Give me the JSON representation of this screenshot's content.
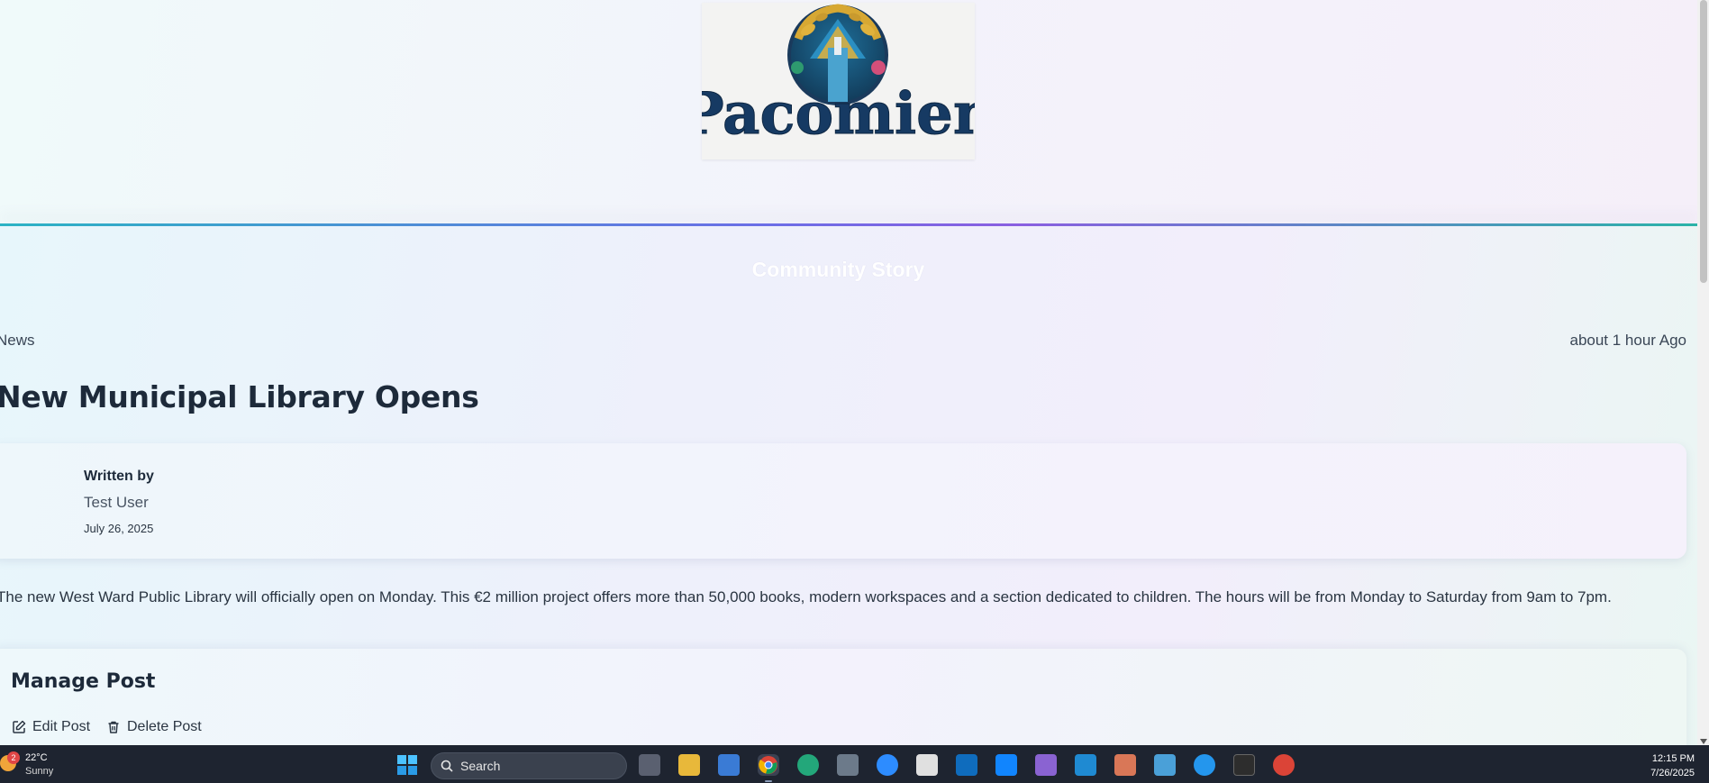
{
  "logo": {
    "text": "Pacomien"
  },
  "section": {
    "title": "Community Story"
  },
  "post": {
    "category": "News",
    "time_ago": "about 1 hour Ago",
    "title": "New Municipal Library Opens",
    "author_label": "Written by",
    "author": "Test User",
    "date": "July 26, 2025",
    "body": "The new West Ward Public Library will officially open on Monday. This €2 million project offers more than 50,000 books, modern workspaces and a section dedicated to children. The hours will be from Monday to Saturday from 9am to 7pm."
  },
  "manage": {
    "title": "Manage Post",
    "edit_label": "Edit Post",
    "delete_label": "Delete Post"
  },
  "taskbar": {
    "weather_temp": "22°C",
    "weather_condition": "Sunny",
    "weather_badge": "2",
    "search_placeholder": "Search",
    "time": "12:15 PM",
    "date": "7/26/2025",
    "pinned_apps": [
      "task-view",
      "file-explorer",
      "microsoft-store",
      "chrome",
      "edge",
      "calculator",
      "messenger",
      "snipping-tool",
      "outlook",
      "bluesky",
      "vs-tool",
      "vscode",
      "claude",
      "notepad",
      "docker",
      "terminal",
      "chrome-profile"
    ]
  }
}
